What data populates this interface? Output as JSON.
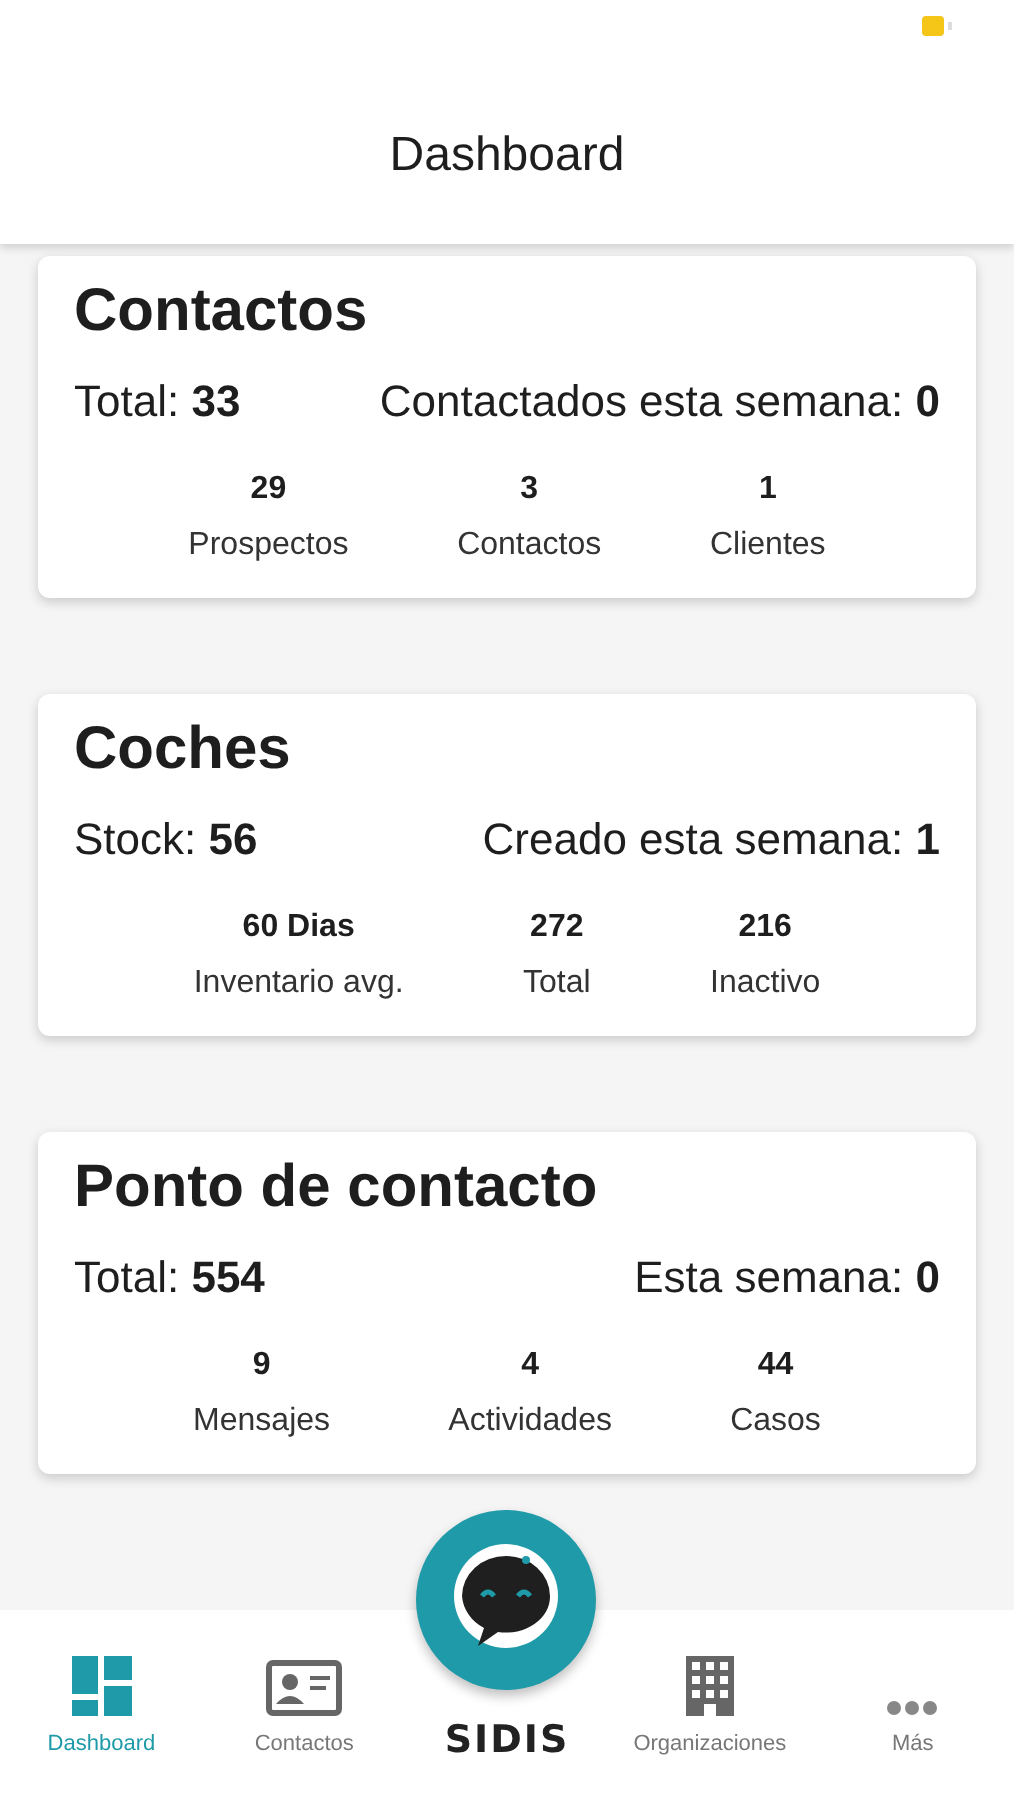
{
  "header": {
    "title": "Dashboard"
  },
  "cards": [
    {
      "title": "Contactos",
      "stats": [
        "Total: **33**",
        "Contactados esta semana: **0**"
      ],
      "metrics": [
        {
          "value": "29",
          "label": "Prospectos"
        },
        {
          "value": "3",
          "label": "Contactos"
        },
        {
          "value": "1",
          "label": "Clientes"
        }
      ]
    },
    {
      "title": "Coches",
      "stats": [
        "Stock: **56**",
        "Creado esta semana: **1**"
      ],
      "metrics": [
        {
          "value": "60 Dias",
          "label": "Inventario avg."
        },
        {
          "value": "272",
          "label": "Total"
        },
        {
          "value": "216",
          "label": "Inactivo"
        }
      ]
    },
    {
      "title": "Ponto de contacto",
      "stats": [
        "Total: **554**",
        "Esta semana: **0**"
      ],
      "metrics": [
        {
          "value": "9",
          "label": "Mensajes"
        },
        {
          "value": "4",
          "label": "Actividades"
        },
        {
          "value": "44",
          "label": "Casos"
        }
      ]
    }
  ],
  "nav": [
    {
      "kind": "tab",
      "label": "Dashboard",
      "selected": true
    },
    {
      "kind": "tab",
      "label": "Contactos",
      "selected": false
    },
    {
      "kind": "logo",
      "label": "SIDIS"
    },
    {
      "kind": "tab",
      "label": "Organizaciones",
      "selected": false
    },
    {
      "kind": "tab",
      "label": "Más",
      "selected": false
    }
  ]
}
